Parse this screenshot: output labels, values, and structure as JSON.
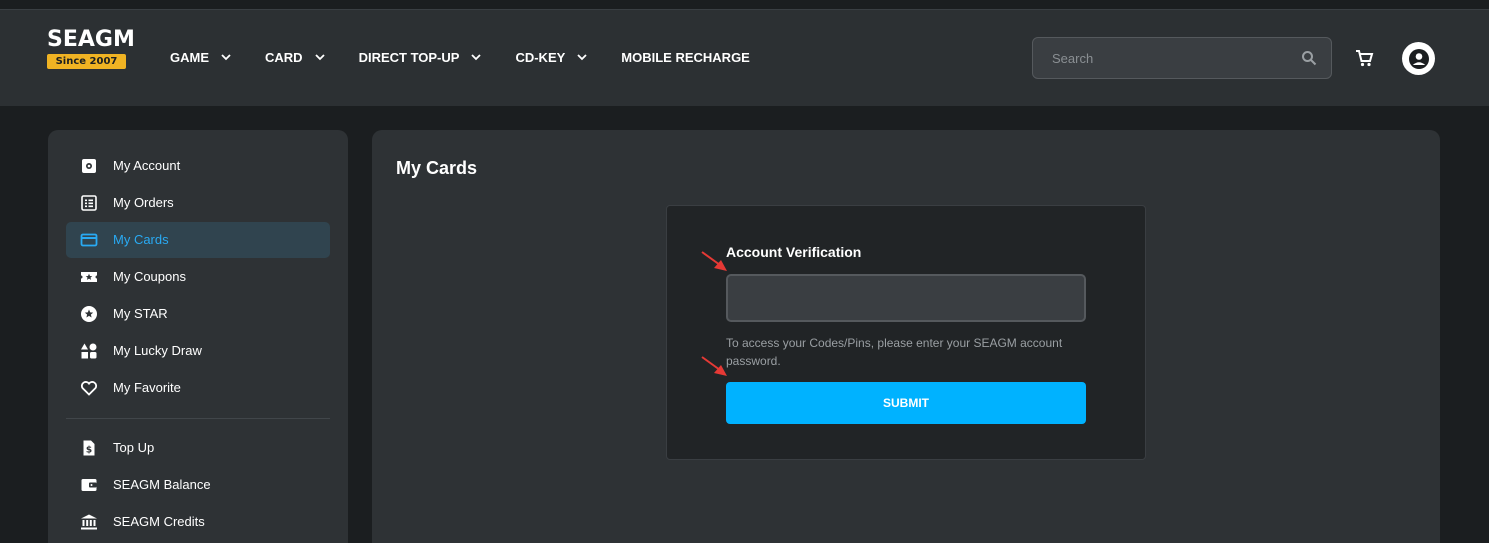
{
  "header": {
    "logo_text": "SEAGM",
    "logo_badge": "Since 2007",
    "nav": [
      {
        "label": "GAME",
        "has_dropdown": true
      },
      {
        "label": "CARD",
        "has_dropdown": true
      },
      {
        "label": "DIRECT TOP-UP",
        "has_dropdown": true
      },
      {
        "label": "CD-KEY",
        "has_dropdown": true
      },
      {
        "label": "MOBILE RECHARGE",
        "has_dropdown": false
      }
    ],
    "search": {
      "placeholder": "Search",
      "value": ""
    },
    "icons": [
      "search-icon",
      "cart-icon",
      "user-avatar-icon"
    ]
  },
  "sidebar": {
    "items": [
      {
        "label": "My Account",
        "icon": "gear-icon",
        "active": false
      },
      {
        "label": "My Orders",
        "icon": "orders-list-icon",
        "active": false
      },
      {
        "label": "My Cards",
        "icon": "credit-card-icon",
        "active": true
      },
      {
        "label": "My Coupons",
        "icon": "ticket-star-icon",
        "active": false
      },
      {
        "label": "My STAR",
        "icon": "star-circle-icon",
        "active": false
      },
      {
        "label": "My Lucky Draw",
        "icon": "shapes-icon",
        "active": false
      },
      {
        "label": "My Favorite",
        "icon": "heart-icon",
        "active": false
      }
    ],
    "items2": [
      {
        "label": "Top Up",
        "icon": "dollar-document-icon"
      },
      {
        "label": "SEAGM Balance",
        "icon": "wallet-icon"
      },
      {
        "label": "SEAGM Credits",
        "icon": "bank-icon"
      }
    ]
  },
  "main": {
    "title": "My Cards",
    "verification": {
      "label": "Account Verification",
      "password_value": "",
      "hint": "To access your Codes/Pins, please enter your SEAGM account password.",
      "submit_label": "SUBMIT"
    }
  },
  "colors": {
    "accent": "#00b2ff",
    "active_text": "#29aaf3",
    "header_bg": "#2c3033",
    "page_bg": "#1b1e20",
    "panel_bg": "#2e3235",
    "annotation_arrow": "#e53935"
  }
}
